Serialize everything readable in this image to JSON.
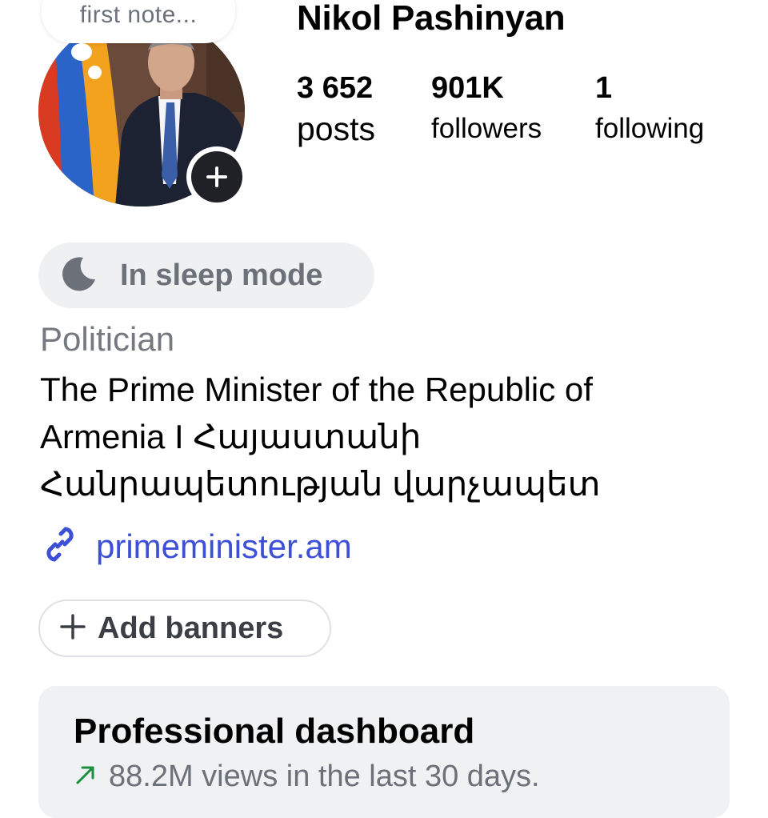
{
  "profile": {
    "username": "Nikol Pashinyan",
    "note": "first note...",
    "avatar_alt": "profile photo"
  },
  "stats": {
    "posts_value": "3 652",
    "posts_label": "posts",
    "followers_value": "901K",
    "followers_label": "followers",
    "following_value": "1",
    "following_label": "following"
  },
  "status": {
    "label": "In sleep mode",
    "icon": "moon-icon"
  },
  "bio": {
    "category": "Politician",
    "lines": [
      "The Prime Minister of the Republic of",
      "Armenia I Հայաստանի",
      "Հանրապետության վարչապետ"
    ],
    "link": "primeminister.am",
    "link_icon": "link-icon"
  },
  "banners": {
    "label": "Add banners",
    "icon": "plus-icon"
  },
  "dashboard": {
    "title": "Professional dashboard",
    "subtitle": "88.2M views in the last 30 days.",
    "trend_icon": "trend-up-arrow-icon",
    "trend_color": "#1a8f3c"
  },
  "colors": {
    "link": "#3d4fd6",
    "muted_text": "#6b7079",
    "pill_bg": "#eef0f2",
    "card_bg": "#eff1f3"
  }
}
